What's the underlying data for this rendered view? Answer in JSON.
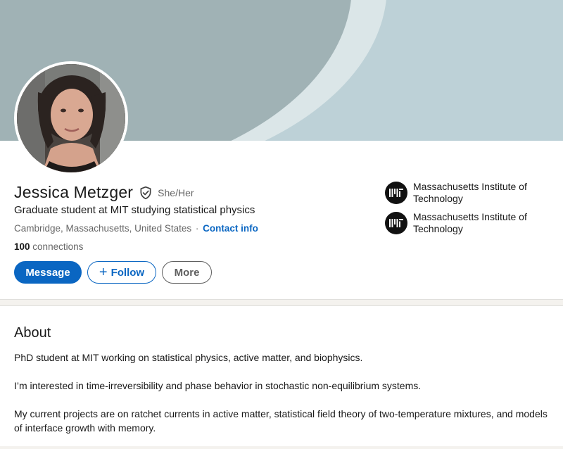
{
  "profile": {
    "name": "Jessica Metzger",
    "pronouns": "She/Her",
    "headline": "Graduate student at MIT studying statistical physics",
    "location": "Cambridge, Massachusetts, United States",
    "separator": "·",
    "contact_label": "Contact info",
    "connections_count": "100",
    "connections_label": "connections"
  },
  "actions": {
    "message_label": "Message",
    "follow_label": "Follow",
    "more_label": "More"
  },
  "education": [
    {
      "name": "Massachusetts Institute of Technology",
      "logo_text": "MIT"
    },
    {
      "name": "Massachusetts Institute of Technology",
      "logo_text": "MIT"
    }
  ],
  "about": {
    "title": "About",
    "paragraphs": [
      "PhD student at MIT working on statistical physics, active matter, and biophysics.",
      "I’m interested in time-irreversibility and phase behavior in stochastic non-equilibrium systems.",
      "My current projects are on ratchet currents in active matter, statistical field theory of two-temperature mixtures, and models of interface growth with memory."
    ]
  },
  "colors": {
    "accent": "#0a66c2",
    "banner": "#bdd1d7",
    "banner_arc": "#a0b2b5"
  },
  "icons": {
    "verified": "shield-check-icon",
    "follow": "plus-icon",
    "school_logo": "mit-logo"
  }
}
